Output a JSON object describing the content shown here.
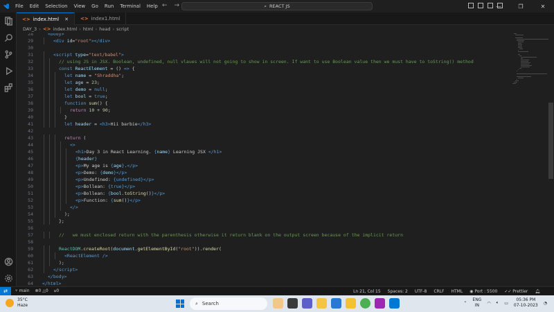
{
  "titlebar": {
    "menu": [
      "File",
      "Edit",
      "Selection",
      "View",
      "Go",
      "Run",
      "Terminal",
      "Help"
    ],
    "search": "REACT JS"
  },
  "tabs": [
    {
      "label": "index.html",
      "active": true
    },
    {
      "label": "index1.html",
      "active": false
    }
  ],
  "breadcrumb": [
    "DAY_3",
    "index.html",
    "html",
    "head",
    "script"
  ],
  "editor": {
    "lines": [
      {
        "n": "28",
        "indent": 0,
        "html": "<span class='t'>&lt;body&gt;</span>"
      },
      {
        "n": "29",
        "indent": 1,
        "html": "<span class='t'>&lt;div</span> <span class='a'>id</span>=<span class='s'>\"root\"</span><span class='t'>&gt;&lt;/div&gt;</span>"
      },
      {
        "n": "30",
        "indent": 0,
        "html": ""
      },
      {
        "n": "31",
        "indent": 1,
        "html": "<span class='t'>&lt;script</span> <span class='a'>type</span>=<span class='s'>\"text/babel\"</span><span class='t'>&gt;</span>"
      },
      {
        "n": "32",
        "indent": 2,
        "html": "<span class='c'>// using JS in JSX. Boolean, undefined, null vlaues will not going to show in screen. If want to use Boolean value then we must have to toString() method</span>"
      },
      {
        "n": "33",
        "indent": 2,
        "html": "<span class='k'>const</span> <span class='v'>ReactElement</span> = () <span class='k'>=&gt;</span> {"
      },
      {
        "n": "34",
        "indent": 3,
        "html": "<span class='k'>let</span> <span class='v'>name</span> = <span class='s'>\"Shraddha\"</span>;"
      },
      {
        "n": "35",
        "indent": 3,
        "html": "<span class='k'>let</span> <span class='v'>age</span> = <span class='num'>23</span>;"
      },
      {
        "n": "36",
        "indent": 3,
        "html": "<span class='k'>let</span> <span class='v'>demo</span> = <span class='k'>null</span>;"
      },
      {
        "n": "37",
        "indent": 3,
        "html": "<span class='k'>let</span> <span class='v'>bool</span> = <span class='k'>true</span>;"
      },
      {
        "n": "38",
        "indent": 3,
        "html": "<span class='k'>function</span> <span class='f'>sum</span>() {"
      },
      {
        "n": "39",
        "indent": 4,
        "html": "<span class='kw'>return</span> <span class='num'>10</span> + <span class='num'>90</span>;"
      },
      {
        "n": "40",
        "indent": 3,
        "html": "}"
      },
      {
        "n": "41",
        "indent": 3,
        "html": "<span class='k'>let</span> <span class='v'>header</span> = <span class='t'>&lt;h3&gt;</span>Hii barbie<span class='t'>&lt;/h3&gt;</span>"
      },
      {
        "n": "42",
        "indent": 0,
        "html": ""
      },
      {
        "n": "43",
        "indent": 3,
        "html": "<span class='kw'>return</span> ("
      },
      {
        "n": "44",
        "indent": 4,
        "html": "<span class='t'>&lt;&gt;</span>"
      },
      {
        "n": "45",
        "indent": 5,
        "html": "<span class='t'>&lt;h1&gt;</span>Day 3 in React Learning. <span class='k'>{</span><span class='v'>name</span><span class='k'>}</span> Learning JSX <span class='t'>&lt;/h1&gt;</span>"
      },
      {
        "n": "46",
        "indent": 5,
        "html": "<span class='k'>{</span><span class='v'>header</span><span class='k'>}</span>"
      },
      {
        "n": "47",
        "indent": 5,
        "html": "<span class='t'>&lt;p&gt;</span>My age is <span class='k'>{</span><span class='v'>age</span><span class='k'>}</span>.<span class='t'>&lt;/p&gt;</span>"
      },
      {
        "n": "48",
        "indent": 5,
        "html": "<span class='t'>&lt;p&gt;</span>Demo: <span class='k'>{</span><span class='v'>demo</span><span class='k'>}</span><span class='t'>&lt;/p&gt;</span>"
      },
      {
        "n": "49",
        "indent": 5,
        "html": "<span class='t'>&lt;p&gt;</span>Undefined: <span class='k'>{</span><span class='k'>undefined</span><span class='k'>}</span><span class='t'>&lt;/p&gt;</span>"
      },
      {
        "n": "50",
        "indent": 5,
        "html": "<span class='t'>&lt;p&gt;</span>Bollean: <span class='k'>{</span><span class='k'>true</span><span class='k'>}</span><span class='t'>&lt;/p&gt;</span>"
      },
      {
        "n": "51",
        "indent": 5,
        "html": "<span class='t'>&lt;p&gt;</span>Bollean: <span class='k'>{</span><span class='v'>bool</span>.<span class='f'>toString</span>()<span class='k'>}</span><span class='t'>&lt;/p&gt;</span>"
      },
      {
        "n": "52",
        "indent": 5,
        "html": "<span class='t'>&lt;p&gt;</span>Function: <span class='k'>{</span><span class='f'>sum</span>()<span class='k'>}</span><span class='t'>&lt;/p&gt;</span>"
      },
      {
        "n": "53",
        "indent": 4,
        "html": "<span class='t'>&lt;/&gt;</span>"
      },
      {
        "n": "54",
        "indent": 3,
        "html": ");"
      },
      {
        "n": "55",
        "indent": 2,
        "html": "};"
      },
      {
        "n": "56",
        "indent": 0,
        "html": ""
      },
      {
        "n": "57",
        "indent": 2,
        "html": "<span class='c'>//   we must enclosed return with the parenthesis otherwise it return blank on the output screen because of the implicit return</span>"
      },
      {
        "n": "58",
        "indent": 0,
        "html": ""
      },
      {
        "n": "59",
        "indent": 2,
        "html": "<span class='v2'>ReactDOM</span>.<span class='f'>createRoot</span>(<span class='v'>document</span>.<span class='f'>getElementById</span>(<span class='s'>\"root\"</span>)).<span class='f'>render</span>("
      },
      {
        "n": "60",
        "indent": 3,
        "html": "<span class='t'>&lt;ReactElement /&gt;</span>"
      },
      {
        "n": "61",
        "indent": 2,
        "html": ");"
      },
      {
        "n": "62",
        "indent": 1,
        "html": "<span class='t'>&lt;/script&gt;</span>"
      },
      {
        "n": "63",
        "indent": 0,
        "html": "<span class='t'>&lt;/body&gt;</span>"
      },
      {
        "n": "64",
        "indent": -1,
        "html": "<span class='t'>&lt;/html&gt;</span>"
      }
    ]
  },
  "statusbar": {
    "branch": "main",
    "errors": "0",
    "warnings": "0",
    "ports": "0",
    "cursor": "Ln 21, Col 15",
    "spaces": "Spaces: 2",
    "encoding": "UTF-8",
    "eol": "CRLF",
    "language": "HTML",
    "port": "Port : 5500",
    "prettier": "Prettier"
  },
  "taskbar": {
    "weather_temp": "35°C",
    "weather_desc": "Haze",
    "search_label": "Search",
    "lang_top": "ENG",
    "lang_bottom": "IN",
    "time": "05:36 PM",
    "date": "07-10-2023"
  },
  "colors": {
    "tag": "#569cd6",
    "attr": "#9cdcfe",
    "string": "#ce9178",
    "comment": "#6a9955",
    "keyword": "#569cd6",
    "control": "#c586c0",
    "function": "#dcdcaa",
    "number": "#b5cea8",
    "class": "#4ec9b0",
    "accent": "#0078d4"
  }
}
